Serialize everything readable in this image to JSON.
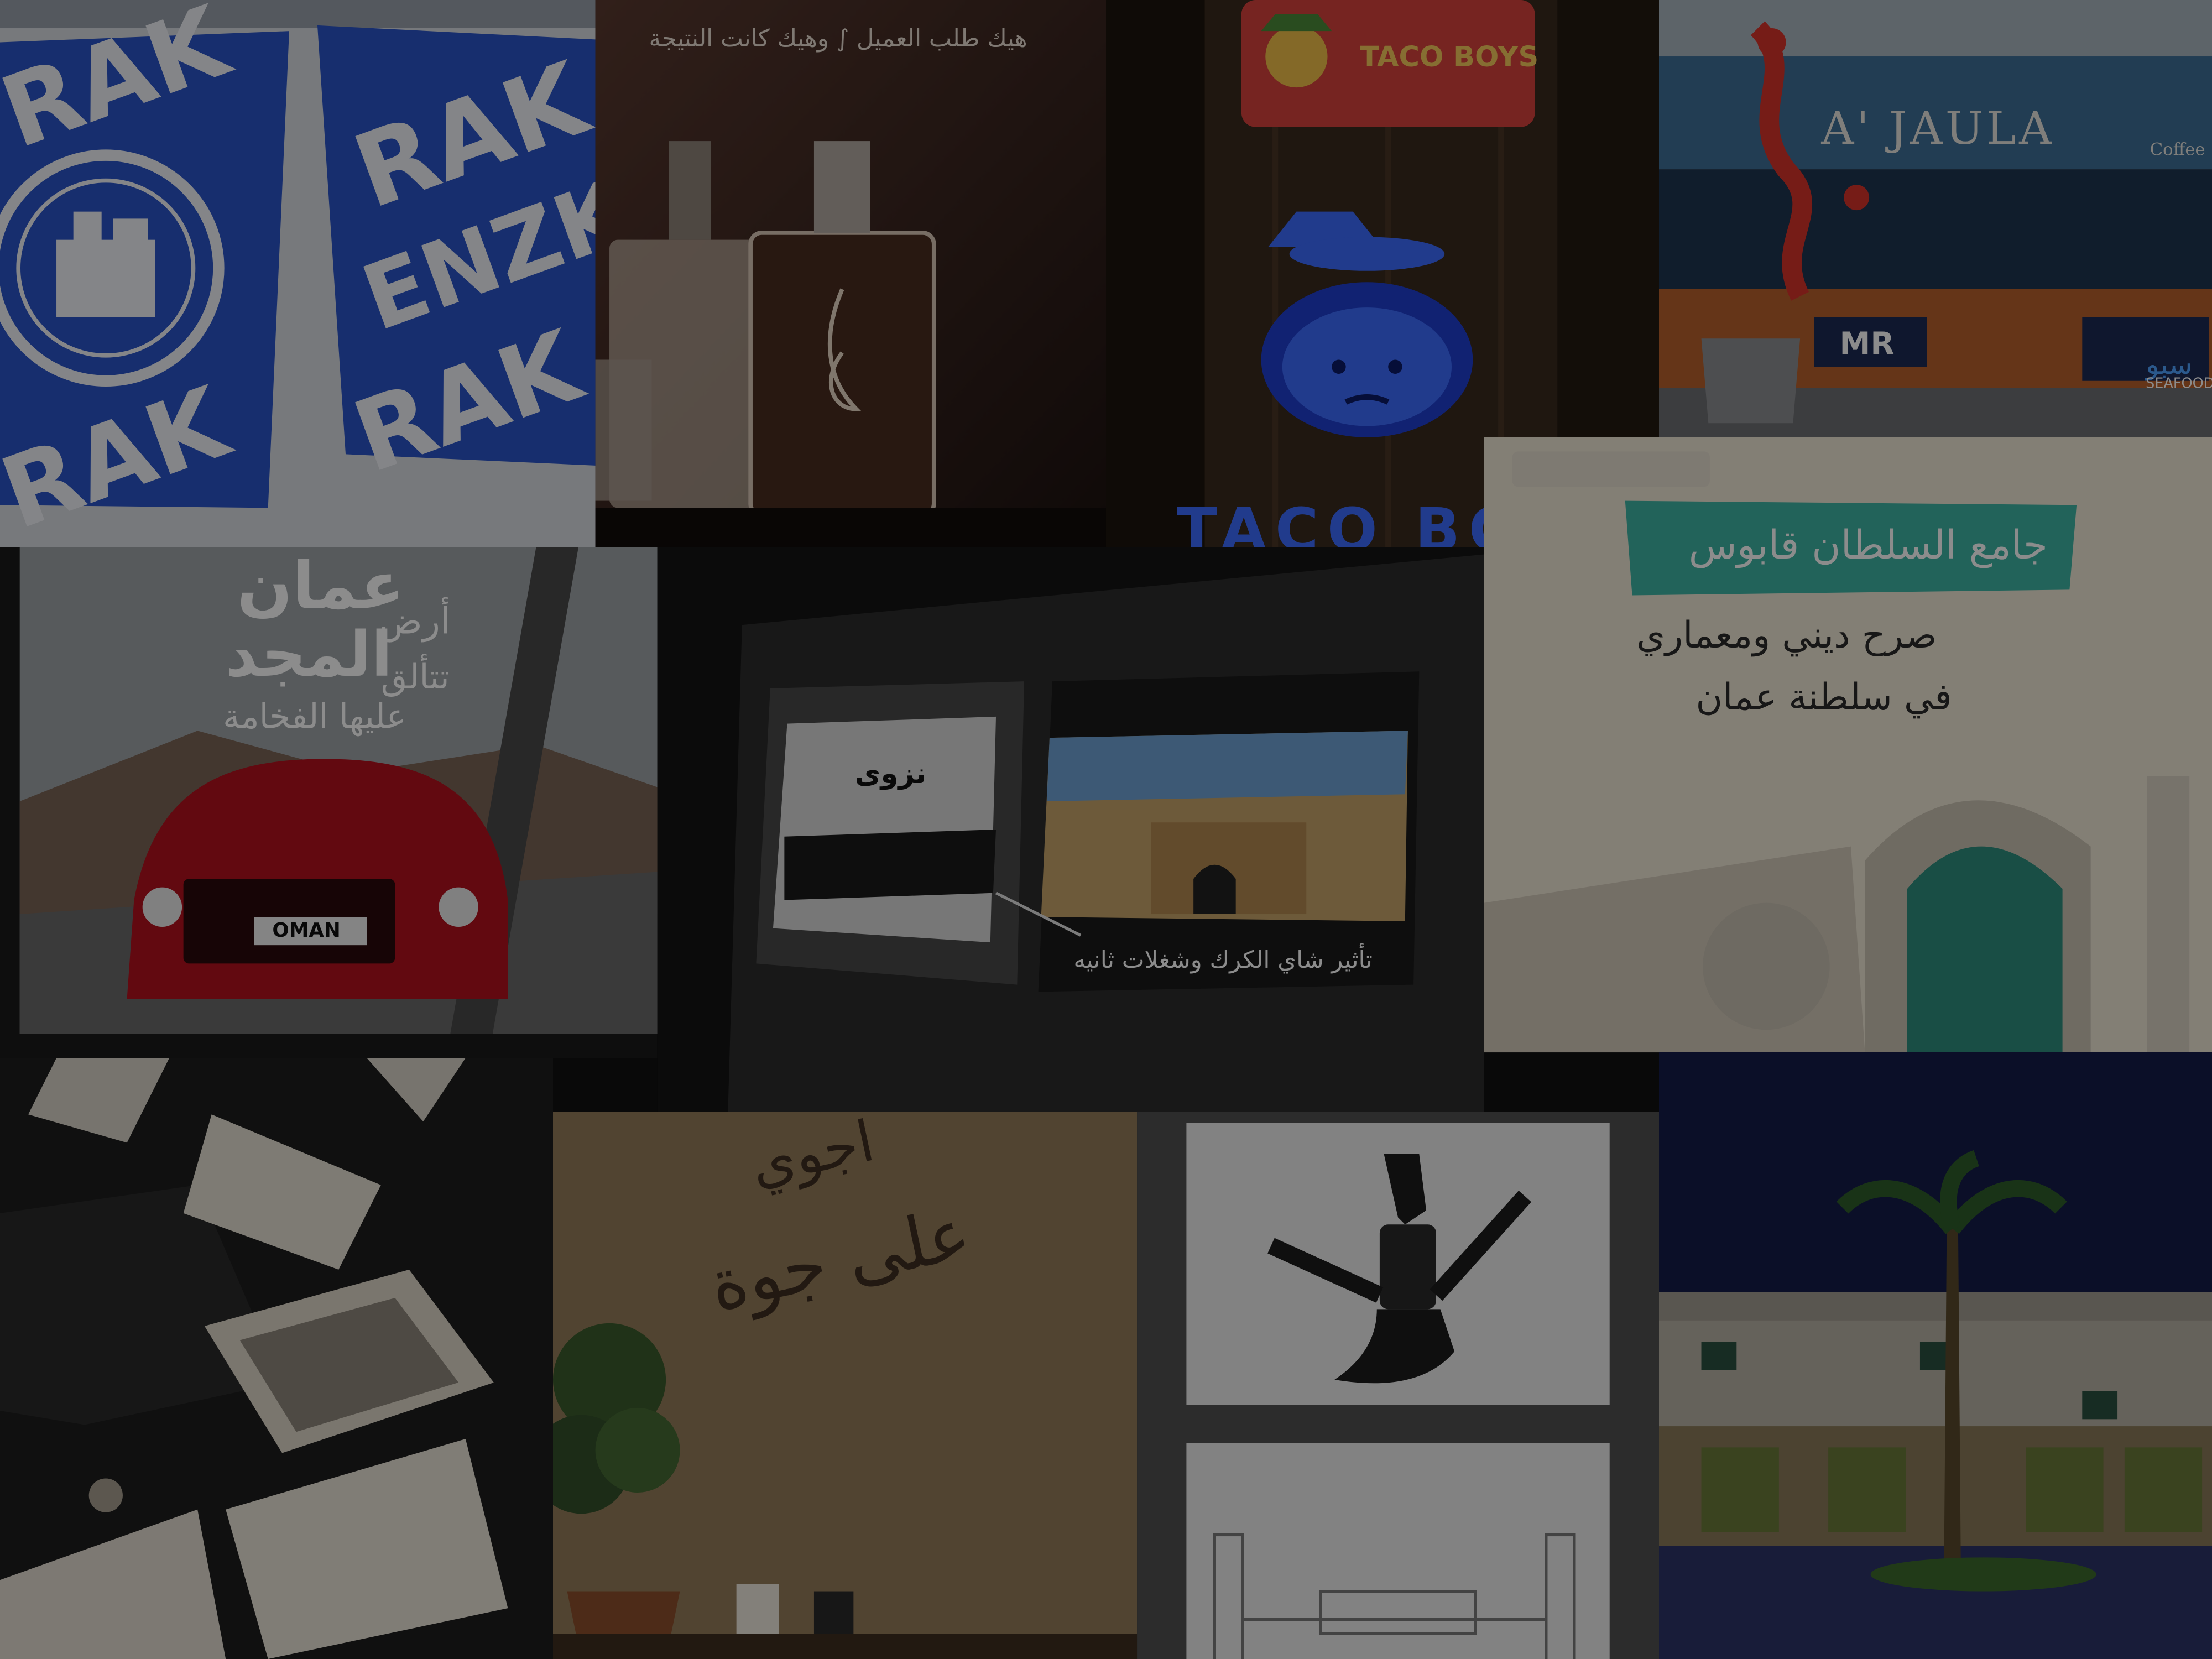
{
  "colors": {
    "overlay": "rgba(0,0,0,0.45)",
    "cup_blue": "#2a55c8",
    "taco_red": "#d8433c",
    "taco_neon": "#3c6cff",
    "oman_car_red": "#b3121e",
    "mosque_banner": "#3fb5a5",
    "night_sky": "#151c4a"
  },
  "tiles": [
    {
      "name": "cups-tile",
      "icon": "blue-cups-image",
      "texts": {
        "pattern": "RAK",
        "pattern2": "ENZK"
      }
    },
    {
      "name": "perfume-tile",
      "icon": "perfume-bottle-image",
      "texts": {
        "caption": "هيك طلب العميل ∫ وهيك كانت النتيجة"
      }
    },
    {
      "name": "taco-boys-tile",
      "icon": "taco-mascot-image",
      "texts": {
        "sign": "TACO BOYS",
        "neon": "TACO BO"
      }
    },
    {
      "name": "ma-jaula-tile",
      "icon": "storefront-image",
      "texts": {
        "facade": "A' JAULA",
        "facade_small": "Coffee",
        "shop_logo": "MR",
        "shop2": "سبو",
        "shop2_sub": "SEAFOOD"
      }
    },
    {
      "name": "oman-car-tile",
      "icon": "red-car-image",
      "texts": {
        "headline": "عمان",
        "line1": "أرض",
        "line2": "المجد",
        "line3": "تتألق",
        "line4": "عليها الفخامة",
        "plate": "OMAN"
      }
    },
    {
      "name": "monitor-tile",
      "icon": "monitor-mockup-image",
      "texts": {
        "sketch_title": "نزوى",
        "caption": "تأثير شاي الكرك وشغلات ثانيه"
      }
    },
    {
      "name": "mosque-tile",
      "icon": "mosque-collage-image",
      "texts": {
        "title": "جامع السلطان قابوس",
        "line1": "صرح ديني ومعماري",
        "line2": "في سلطنة عمان"
      }
    },
    {
      "name": "gift-box-tile",
      "icon": "gift-box-image",
      "texts": {}
    },
    {
      "name": "cafe-wall-tile",
      "icon": "cafe-wall-image",
      "texts": {
        "wall1": "اجوي",
        "wall2": "على جوة"
      }
    },
    {
      "name": "khanjar-tile",
      "icon": "khanjar-sketch-image",
      "texts": {}
    },
    {
      "name": "night-building-tile",
      "icon": "night-building-image",
      "texts": {}
    }
  ]
}
